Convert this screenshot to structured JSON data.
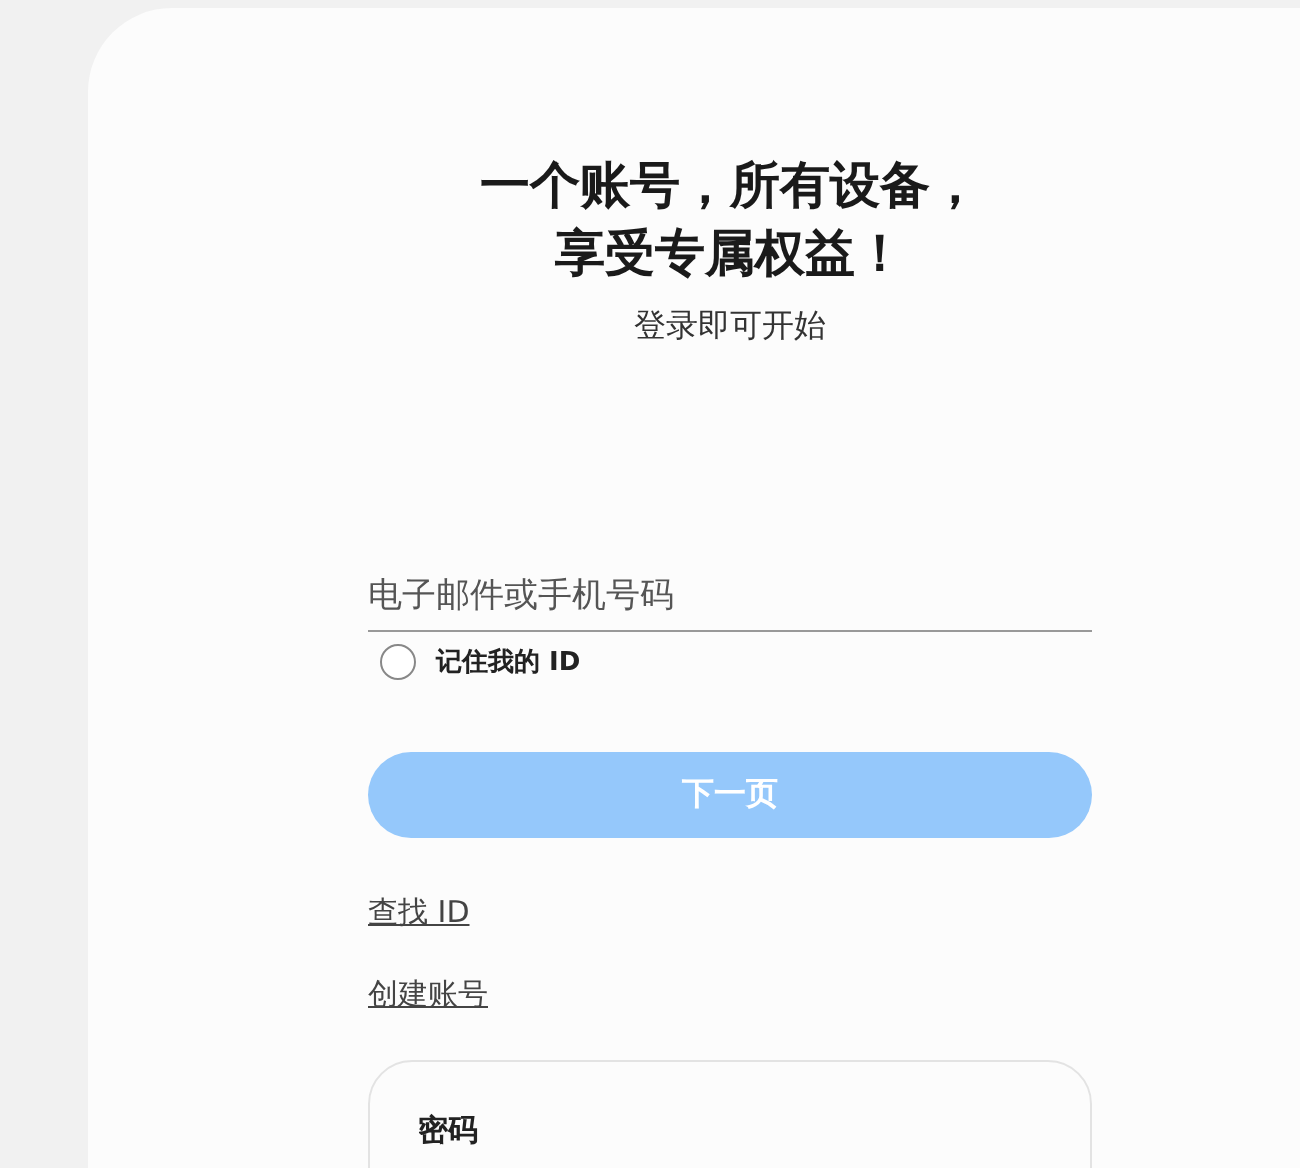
{
  "heading": {
    "lines": [
      "一个账号，所有设备，",
      "享受专属权益！"
    ],
    "subtitle": "登录即可开始"
  },
  "id_field": {
    "placeholder": "电子邮件或手机号码"
  },
  "remember": {
    "label": "记住我的 ID",
    "checked": false
  },
  "next_button": {
    "label": "下一页",
    "disabled": true
  },
  "links": [
    "查找 ID",
    "创建账号"
  ],
  "password_card": {
    "label": "密码"
  }
}
